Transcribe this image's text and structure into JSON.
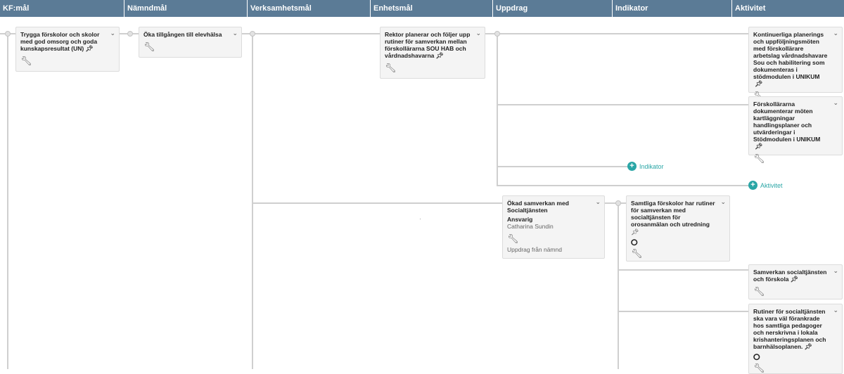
{
  "columns": [
    {
      "label": "KF:mål"
    },
    {
      "label": "Nämndmål"
    },
    {
      "label": "Verksamhetsmål"
    },
    {
      "label": "Enhetsmål"
    },
    {
      "label": "Uppdrag"
    },
    {
      "label": "Indikator"
    },
    {
      "label": "Aktivitet"
    }
  ],
  "icons": {
    "pin": "pin-icon",
    "wrench": "wrench-icon",
    "chevron": "chevron-down-icon",
    "gauge": "gauge-icon",
    "plus": "plus-icon"
  },
  "colors": {
    "header": "#5b7b96",
    "accent": "#2aa6a6",
    "card": "#f4f4f4"
  },
  "cards": {
    "kf1": {
      "title": "Trygga förskolor och skolor med god omsorg och goda kunskapsresultat (UN)"
    },
    "namnd1": {
      "title": "Öka tillgången till elevhälsa"
    },
    "enhet1": {
      "title": "Rektor planerar och följer upp rutiner för samverkan mellan förskollärarna SOU HAB och vårdnadshavarna"
    },
    "akt1": {
      "title": "Kontinuerliga planerings och uppföljningsmöten med förskollärare arbetslag vårdnadshavare Sou och habilitering som dokumenteras i stödmodulen i UNIKUM"
    },
    "akt2": {
      "title": "Förskollärarna dokumenterar möten kartläggningar handlingsplaner och utvärderingar i Stödmodulen i UNIKUM"
    },
    "uppdrag1": {
      "title": "Ökad samverkan med Socialtjänsten",
      "responsible_label": "Ansvarig",
      "responsible_name": "Catharina Sundin",
      "source": "Uppdrag från nämnd"
    },
    "ind1": {
      "title": "Samtliga förskolor har rutiner för samverkan med socialtjänsten för orosanmälan och utredning"
    },
    "akt3": {
      "title": "Samverkan socialtjänsten och förskola"
    },
    "akt4": {
      "title": "Rutiner för socialtjänsten ska vara väl förankrade hos samtliga pedagoger och nerskrivna i lokala krishanteringsplanen och barnhälsoplanen."
    }
  },
  "add_buttons": {
    "indikator": "Indikator",
    "aktivitet": "Aktivitet"
  },
  "dot_center": "·"
}
